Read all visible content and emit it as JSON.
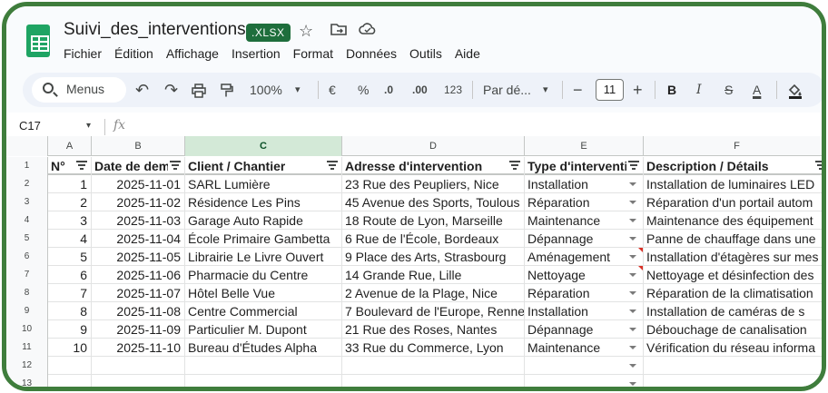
{
  "document": {
    "title": "Suivi_des_interventions",
    "format_badge": ".XLSX"
  },
  "title_icons": {
    "star": "☆",
    "move": "⇱",
    "cloud": "☁"
  },
  "menu": [
    "Fichier",
    "Édition",
    "Affichage",
    "Insertion",
    "Format",
    "Données",
    "Outils",
    "Aide"
  ],
  "toolbar": {
    "search_label": "Menus",
    "undo": "↶",
    "redo": "↷",
    "print": "⎙",
    "paint_format": "⌐",
    "zoom": "100%",
    "currency": "€",
    "percent": "%",
    "decrease_decimals": ".0",
    "increase_decimals": ".00",
    "number_format_123": "123",
    "font_family": "Par dé...",
    "font_size_minus": "−",
    "font_size": "11",
    "font_size_plus": "+",
    "bold": "B",
    "italic": "I",
    "strikethrough": "S",
    "text_color": "A",
    "dropdown_arrow": "▾"
  },
  "formula_bar": {
    "name_box": "C17",
    "fx": "fx"
  },
  "grid": {
    "column_letters": [
      "A",
      "B",
      "C",
      "D",
      "E",
      "F"
    ],
    "selected_column": "C",
    "row_numbers": [
      "1",
      "2",
      "3",
      "4",
      "5",
      "6",
      "7",
      "8",
      "9",
      "10",
      "11",
      "12",
      "13"
    ],
    "headers": [
      "N°",
      "Date de dema",
      "Client / Chantier",
      "Adresse d'intervention",
      "Type d'interventio",
      "Description / Détails"
    ],
    "rows": [
      [
        "1",
        "2025-11-01",
        "SARL Lumière",
        "23 Rue des Peupliers, Nice",
        "Installation",
        "Installation de luminaires LED"
      ],
      [
        "2",
        "2025-11-02",
        "Résidence Les Pins",
        "45 Avenue des Sports, Toulous",
        "Réparation",
        "Réparation d'un portail autom"
      ],
      [
        "3",
        "2025-11-03",
        "Garage Auto Rapide",
        "18 Route de Lyon, Marseille",
        "Maintenance",
        "Maintenance des équipement"
      ],
      [
        "4",
        "2025-11-04",
        "École Primaire Gambetta",
        "6 Rue de l'École, Bordeaux",
        "Dépannage",
        "Panne de chauffage dans une"
      ],
      [
        "5",
        "2025-11-05",
        "Librairie Le Livre Ouvert",
        "9 Place des Arts, Strasbourg",
        "Aménagement",
        "Installation d'étagères sur mes"
      ],
      [
        "6",
        "2025-11-06",
        "Pharmacie du Centre",
        "14 Grande Rue, Lille",
        "Nettoyage",
        "Nettoyage et désinfection des"
      ],
      [
        "7",
        "2025-11-07",
        "Hôtel Belle Vue",
        "2 Avenue de la Plage, Nice",
        "Réparation",
        "Réparation de la climatisation"
      ],
      [
        "8",
        "2025-11-08",
        "Centre Commercial",
        "7 Boulevard de l'Europe, Renne",
        "Installation",
        "Installation de caméras de s"
      ],
      [
        "9",
        "2025-11-09",
        "Particulier M. Dupont",
        "21 Rue des Roses, Nantes",
        "Dépannage",
        "Débouchage de canalisation"
      ],
      [
        "10",
        "2025-11-10",
        "Bureau d'Études Alpha",
        "33 Rue du Commerce, Lyon",
        "Maintenance",
        "Vérification du réseau informa"
      ],
      [
        "",
        "",
        "",
        "",
        "",
        ""
      ],
      [
        "",
        "",
        "",
        "",
        "",
        ""
      ]
    ],
    "colors": {
      "frame": "#3f7d3c",
      "selected_column_header": "#d3e9d7",
      "note_marker": "#d93025",
      "format_badge": "#1e6e3c"
    }
  }
}
